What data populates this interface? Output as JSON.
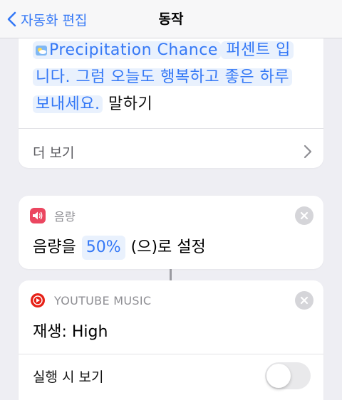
{
  "nav": {
    "back_label": "자동화 편집",
    "title": "동작"
  },
  "text_card": {
    "line1_token": "Precipitation Chance",
    "line1_text": " 퍼센트 입",
    "line2_text": "니다. 그럼 오늘도 행복하고 좋은 하루",
    "line3_text": "보내세요.",
    "line3_suffix": "말하기",
    "more_label": "더 보기"
  },
  "volume_action": {
    "name": "음량",
    "prefix": "음량을",
    "value": "50%",
    "suffix": "(으)로 설정",
    "icon": "speaker-icon"
  },
  "music_action": {
    "name": "YOUTUBE MUSIC",
    "body": "재생: High",
    "toggle_label": "실행 시 보기",
    "toggle_on": false,
    "icon": "youtube-music-icon"
  },
  "colors": {
    "accent": "#3478f6",
    "token_bg": "#e9f1fd",
    "volume_icon": "#eb4660",
    "youtube_red": "#e62117",
    "background": "#eeeef3"
  }
}
